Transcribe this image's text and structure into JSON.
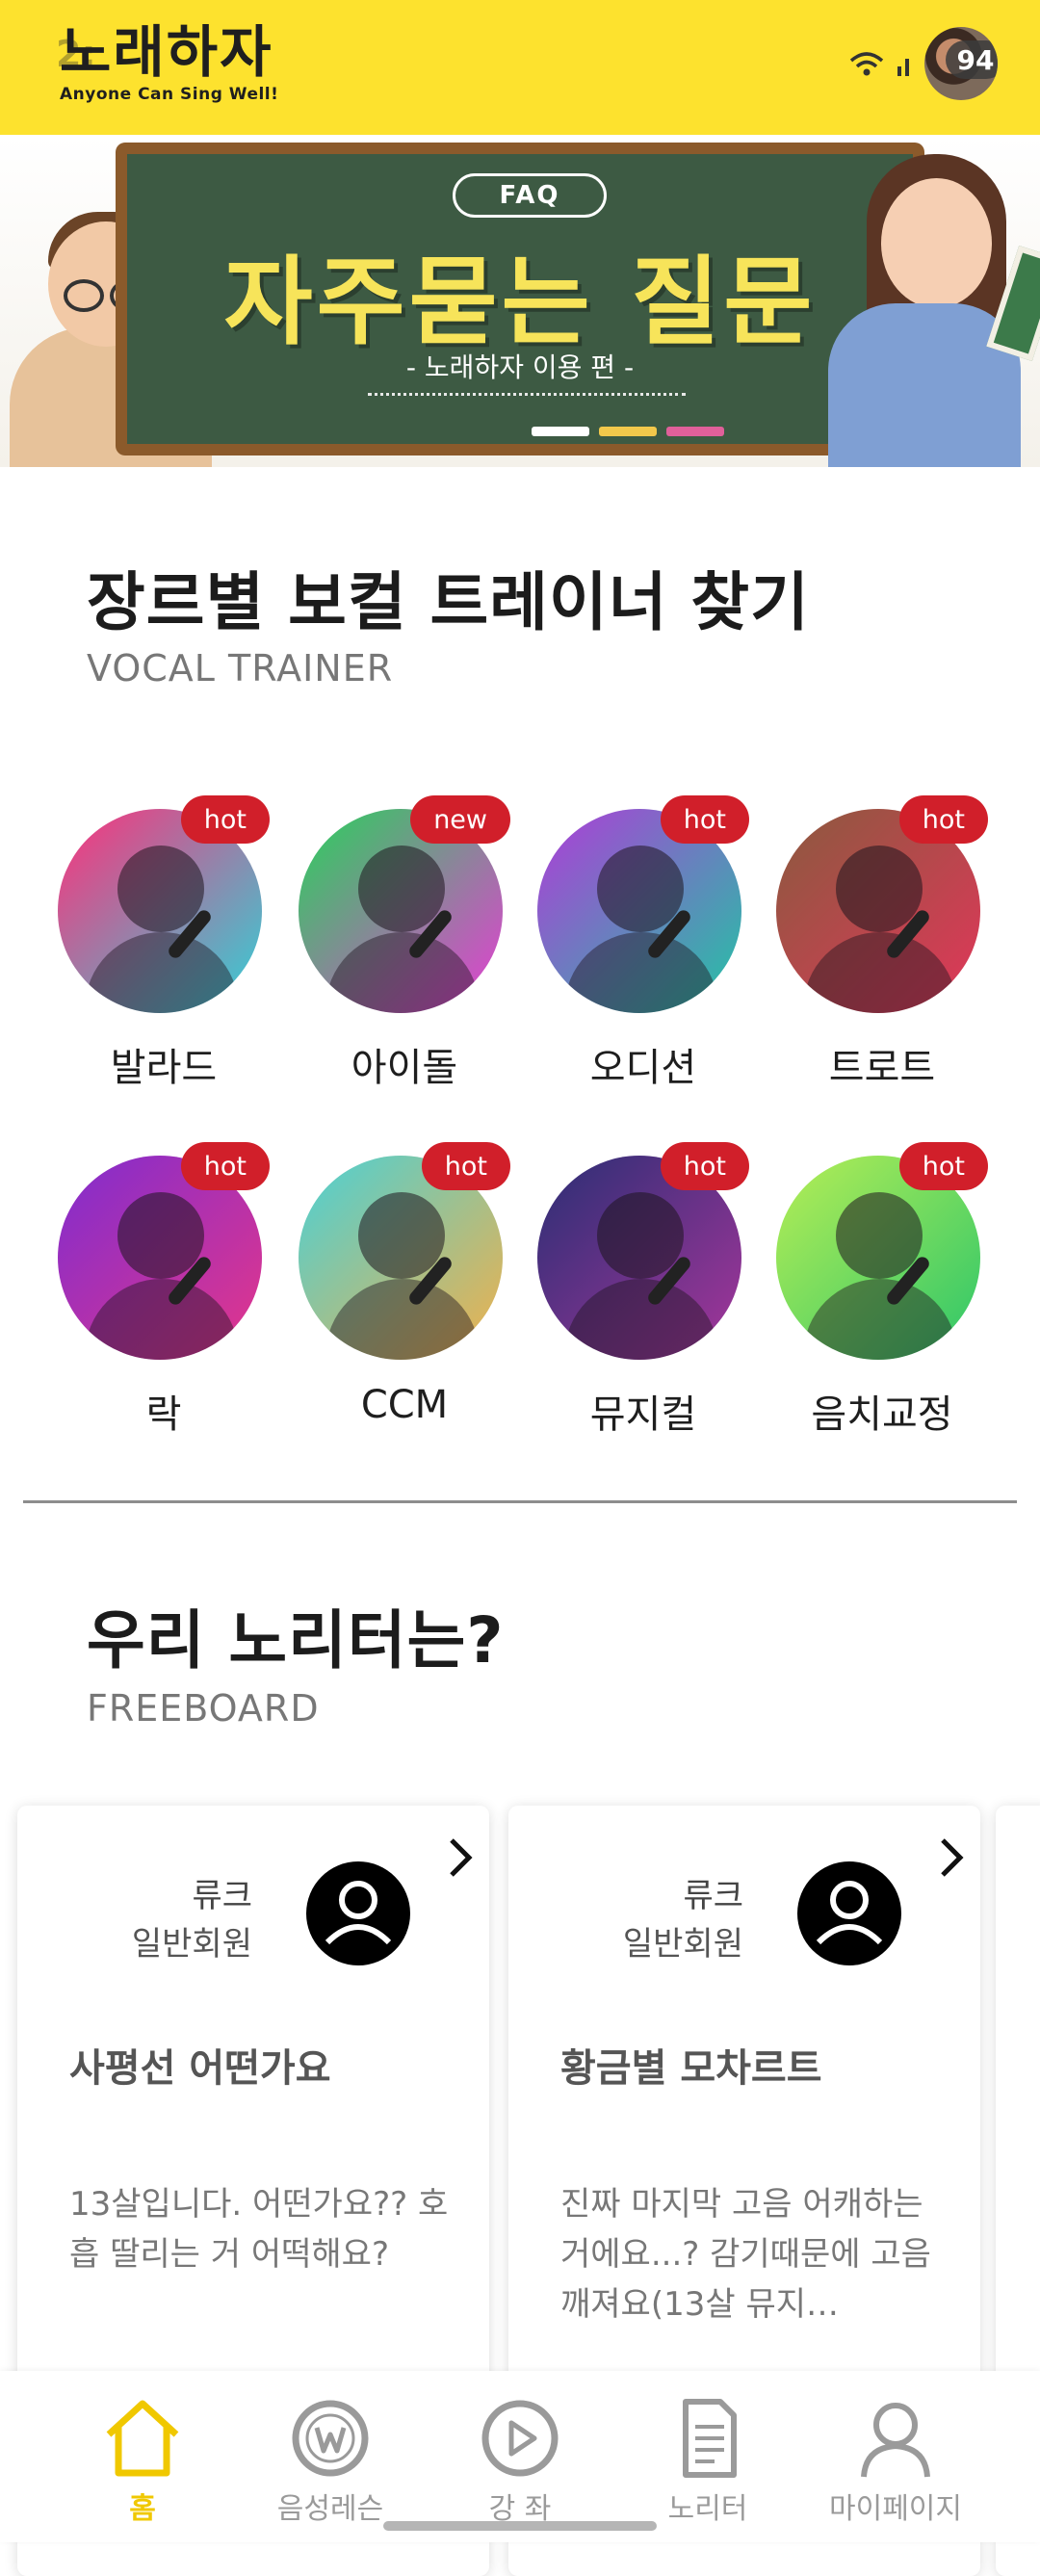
{
  "status_bar": {
    "time": "2:",
    "battery": "94"
  },
  "header": {
    "logo_text": "노래하자",
    "logo_tagline": "Anyone Can Sing Well!"
  },
  "banner": {
    "pill": "FAQ",
    "title": "자주묻는 질문",
    "subtitle": "- 노래하자 이용 편 -"
  },
  "trainers": {
    "title": "장르별 보컬 트레이너 찾기",
    "subtitle": "VOCAL TRAINER",
    "genres": [
      {
        "label": "발라드",
        "badge": "hot",
        "colors": [
          "#ff2f7a",
          "#2fd3d8"
        ]
      },
      {
        "label": "아이돌",
        "badge": "new",
        "colors": [
          "#27d35a",
          "#e93bd6"
        ]
      },
      {
        "label": "오디션",
        "badge": "hot",
        "colors": [
          "#b03bd8",
          "#20c6a4"
        ]
      },
      {
        "label": "트로트",
        "badge": "hot",
        "colors": [
          "#8a5a3e",
          "#e2365a"
        ]
      },
      {
        "label": "락",
        "badge": "hot",
        "colors": [
          "#7f2ccf",
          "#e5368a"
        ]
      },
      {
        "label": "CCM",
        "badge": "hot",
        "colors": [
          "#4ad1d6",
          "#f2b04a"
        ]
      },
      {
        "label": "뮤지컬",
        "badge": "hot",
        "colors": [
          "#2a2e74",
          "#a6369b"
        ]
      },
      {
        "label": "음치교정",
        "badge": "hot",
        "colors": [
          "#b7ee55",
          "#2cc66a"
        ]
      }
    ]
  },
  "freeboard": {
    "title": "우리 노리터는?",
    "subtitle": "FREEBOARD",
    "cards": [
      {
        "author": "류크",
        "role": "일반회원",
        "title": "사평선 어떤가요",
        "body": "13살입니다. 어떤가요?? 호흡 딸리는 거 어떡해요?"
      },
      {
        "author": "류크",
        "role": "일반회원",
        "title": "황금별 모차르트",
        "body": "진짜 마지막 고음 어캐하는거에요...? 감기때문에 고음깨져요(13살 뮤지…"
      }
    ]
  },
  "nav": {
    "items": [
      {
        "label": "홈",
        "icon": "home-icon",
        "active": true
      },
      {
        "label": "음성레슨",
        "icon": "w-circle-icon",
        "active": false
      },
      {
        "label": "강 좌",
        "icon": "play-circle-icon",
        "active": false
      },
      {
        "label": "노리터",
        "icon": "document-icon",
        "active": false
      },
      {
        "label": "마이페이지",
        "icon": "person-icon",
        "active": false
      }
    ],
    "active_color": "#F0C800",
    "inactive_color": "#9A9A9A"
  },
  "colors": {
    "header_bg": "#FDE22E",
    "badge": "#D11F2A"
  }
}
